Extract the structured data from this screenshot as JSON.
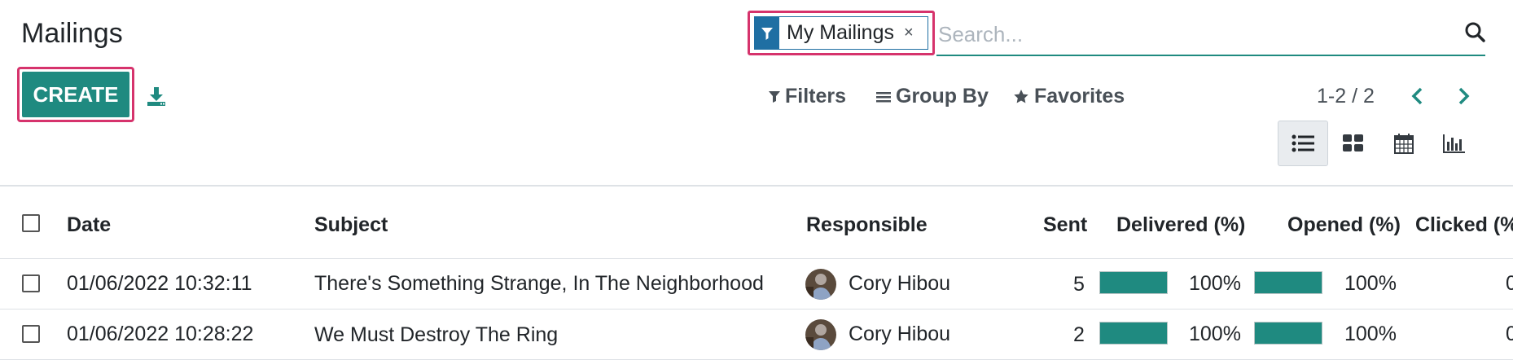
{
  "page": {
    "title": "Mailings"
  },
  "toolbar": {
    "create_label": "CREATE"
  },
  "search": {
    "facet_label": "My Mailings",
    "facet_remove": "×",
    "placeholder": "Search...",
    "value": ""
  },
  "controls": {
    "filters": "Filters",
    "group_by": "Group By",
    "favorites": "Favorites"
  },
  "pager": {
    "text": "1-2 / 2"
  },
  "views": [
    {
      "name": "list",
      "active": true
    },
    {
      "name": "kanban",
      "active": false
    },
    {
      "name": "calendar",
      "active": false
    },
    {
      "name": "graph",
      "active": false
    }
  ],
  "table": {
    "headers": {
      "date": "Date",
      "subject": "Subject",
      "responsible": "Responsible",
      "sent": "Sent",
      "delivered": "Delivered (%)",
      "opened": "Opened (%)",
      "clicked": "Clicked (%"
    },
    "rows": [
      {
        "date": "01/06/2022 10:32:11",
        "subject": "There's Something Strange, In The Neighborhood",
        "responsible": "Cory Hibou",
        "sent": "5",
        "delivered": "100%",
        "delivered_value": 100,
        "opened": "100%",
        "opened_value": 100,
        "clicked": "0"
      },
      {
        "date": "01/06/2022 10:28:22",
        "subject": "We Must Destroy The Ring",
        "responsible": "Cory Hibou",
        "sent": "2",
        "delivered": "100%",
        "delivered_value": 100,
        "opened": "100%",
        "opened_value": 100,
        "clicked": "0"
      }
    ]
  },
  "colors": {
    "accent": "#1f8a80",
    "highlight": "#d6336c",
    "facet": "#1f6fa3"
  }
}
